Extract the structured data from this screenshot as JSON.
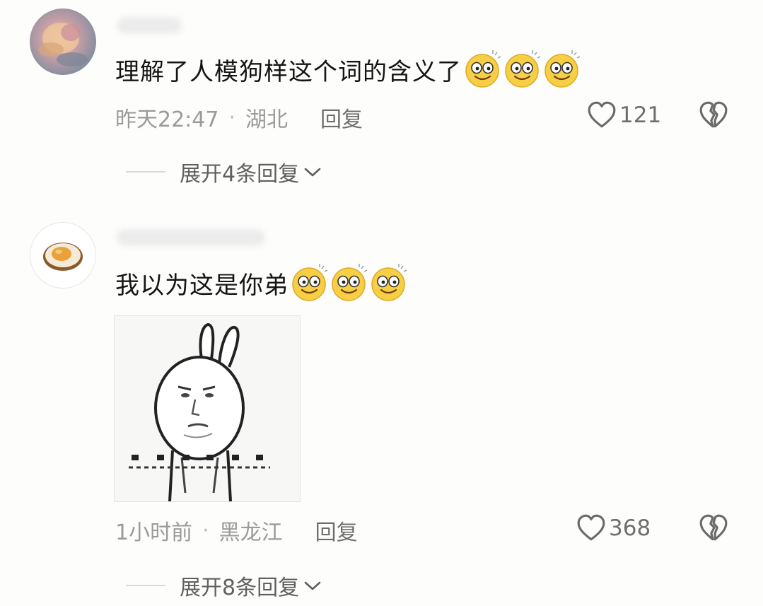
{
  "comments": [
    {
      "text": "理解了人模狗样这个词的含义了",
      "emoji_count": 3,
      "time": "昨天22:47",
      "location": "湖北",
      "reply_label": "回复",
      "likes": "121",
      "expand_label": "展开4条回复"
    },
    {
      "text": "我以为这是你弟",
      "emoji_count": 3,
      "time": "1小时前",
      "location": "黑龙江",
      "reply_label": "回复",
      "likes": "368",
      "expand_label": "展开8条回复"
    }
  ],
  "separator": "·",
  "icons": {
    "like": "heart-outline-icon",
    "dislike": "broken-heart-icon",
    "expand": "chevron-down-icon",
    "emoji": "dizzy-eyes-smile-emoji"
  },
  "colors": {
    "text_primary": "#151515",
    "text_meta": "#9a9a9a",
    "emoji_yellow": "#f6cf45"
  }
}
